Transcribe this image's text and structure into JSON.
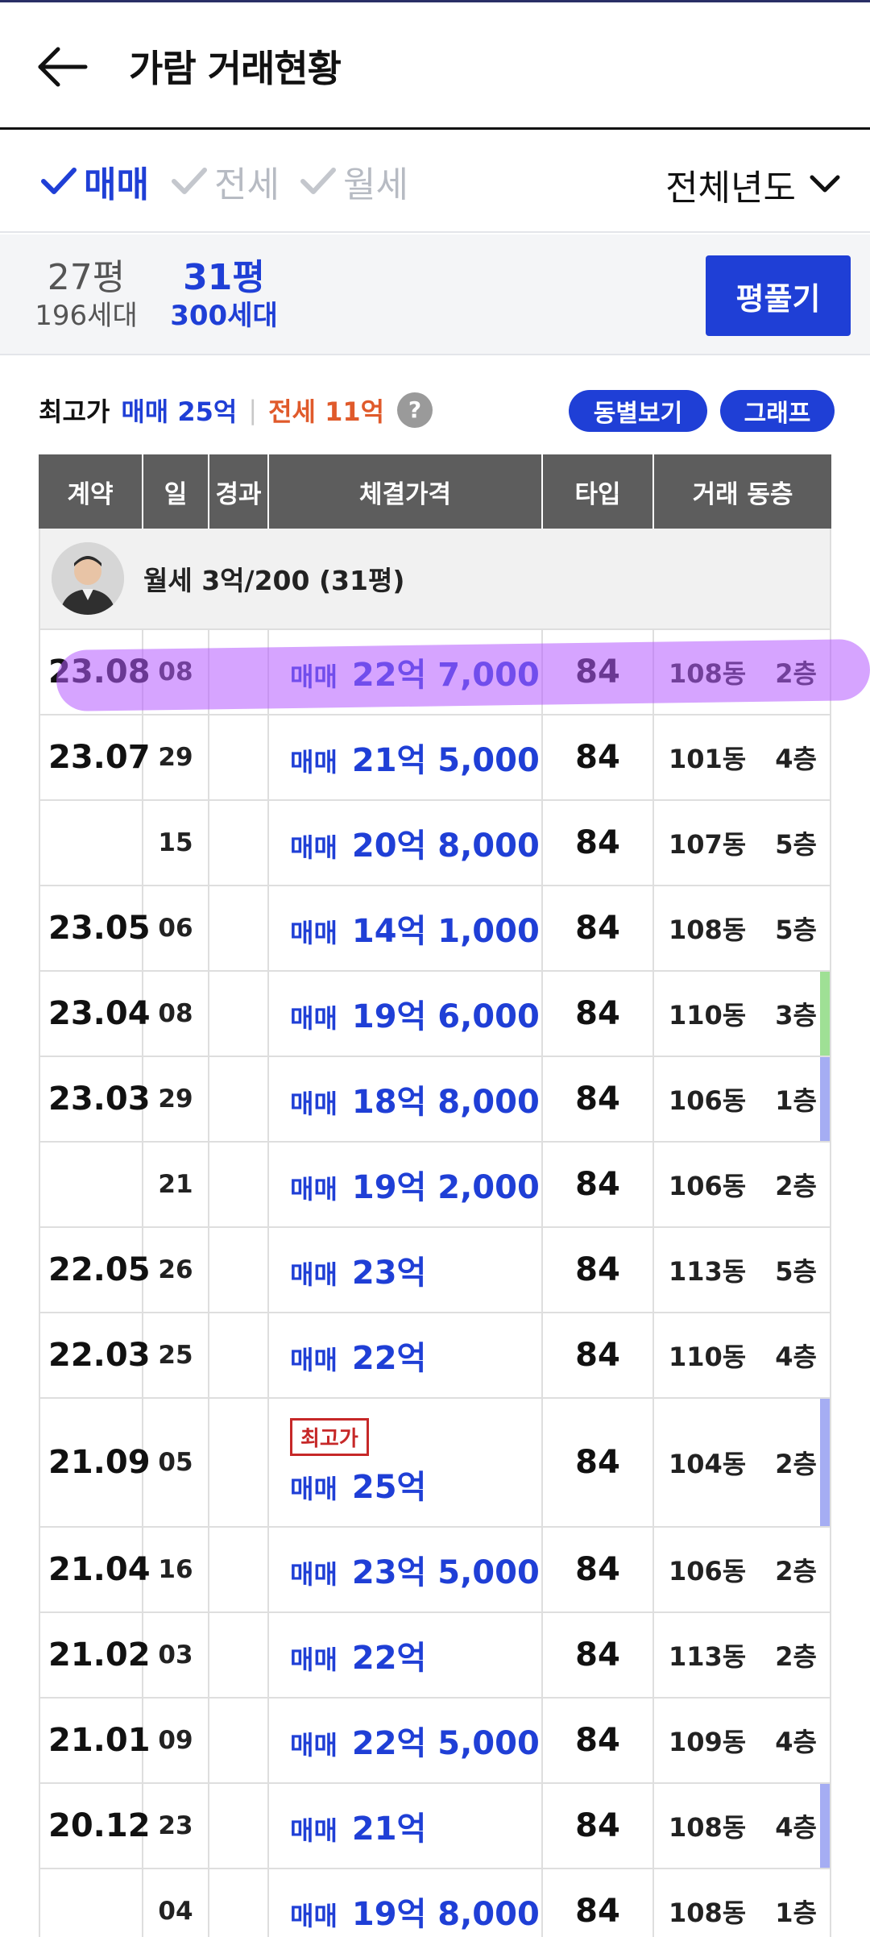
{
  "header": {
    "title": "가람 거래현황"
  },
  "filters": {
    "options": [
      {
        "label": "매매",
        "active": true
      },
      {
        "label": "전세",
        "active": false
      },
      {
        "label": "월세",
        "active": false
      }
    ],
    "year_select": "전체년도"
  },
  "pyeong": {
    "options": [
      {
        "size": "27평",
        "households": "196세대",
        "active": false
      },
      {
        "size": "31평",
        "households": "300세대",
        "active": true
      }
    ],
    "expand_button": "평풀기"
  },
  "summary": {
    "label": "최고가",
    "sale_max": "매매 25억",
    "jeonse_max": "전세 11억",
    "buttons": {
      "by_dong": "동별보기",
      "graph": "그래프"
    }
  },
  "table": {
    "headers": [
      "계약",
      "일",
      "경과",
      "체결가격",
      "타입",
      "거래 동층"
    ],
    "rent_notice": "월세 3억/200 (31평)",
    "rows": [
      {
        "month": "23.08",
        "day": "08",
        "kind": "매매",
        "price": "22억 7,000",
        "type": "84",
        "dong": "108동",
        "floor": "2층"
      },
      {
        "month": "23.07",
        "day": "29",
        "kind": "매매",
        "price": "21억 5,000",
        "type": "84",
        "dong": "101동",
        "floor": "4층"
      },
      {
        "month": "",
        "day": "15",
        "kind": "매매",
        "price": "20억 8,000",
        "type": "84",
        "dong": "107동",
        "floor": "5층"
      },
      {
        "month": "23.05",
        "day": "06",
        "kind": "매매",
        "price": "14억 1,000",
        "type": "84",
        "dong": "108동",
        "floor": "5층"
      },
      {
        "month": "23.04",
        "day": "08",
        "kind": "매매",
        "price": "19억 6,000",
        "type": "84",
        "dong": "110동",
        "floor": "3층",
        "bar": "#9fe095"
      },
      {
        "month": "23.03",
        "day": "29",
        "kind": "매매",
        "price": "18억 8,000",
        "type": "84",
        "dong": "106동",
        "floor": "1층",
        "bar": "#a5adf3"
      },
      {
        "month": "",
        "day": "21",
        "kind": "매매",
        "price": "19억 2,000",
        "type": "84",
        "dong": "106동",
        "floor": "2층"
      },
      {
        "month": "22.05",
        "day": "26",
        "kind": "매매",
        "price": "23억",
        "type": "84",
        "dong": "113동",
        "floor": "5층"
      },
      {
        "month": "22.03",
        "day": "25",
        "kind": "매매",
        "price": "22억",
        "type": "84",
        "dong": "110동",
        "floor": "4층"
      },
      {
        "month": "21.09",
        "day": "05",
        "kind": "매매",
        "price": "25억",
        "type": "84",
        "dong": "104동",
        "floor": "2층",
        "badge": "최고가",
        "bar": "#a5adf3"
      },
      {
        "month": "21.04",
        "day": "16",
        "kind": "매매",
        "price": "23억 5,000",
        "type": "84",
        "dong": "106동",
        "floor": "2층"
      },
      {
        "month": "21.02",
        "day": "03",
        "kind": "매매",
        "price": "22억",
        "type": "84",
        "dong": "113동",
        "floor": "2층"
      },
      {
        "month": "21.01",
        "day": "09",
        "kind": "매매",
        "price": "22억 5,000",
        "type": "84",
        "dong": "109동",
        "floor": "4층"
      },
      {
        "month": "20.12",
        "day": "23",
        "kind": "매매",
        "price": "21억",
        "type": "84",
        "dong": "108동",
        "floor": "4층",
        "bar": "#a5adf3"
      },
      {
        "month": "",
        "day": "04",
        "kind": "매매",
        "price": "19억 8,000",
        "type": "84",
        "dong": "108동",
        "floor": "1층"
      }
    ]
  }
}
